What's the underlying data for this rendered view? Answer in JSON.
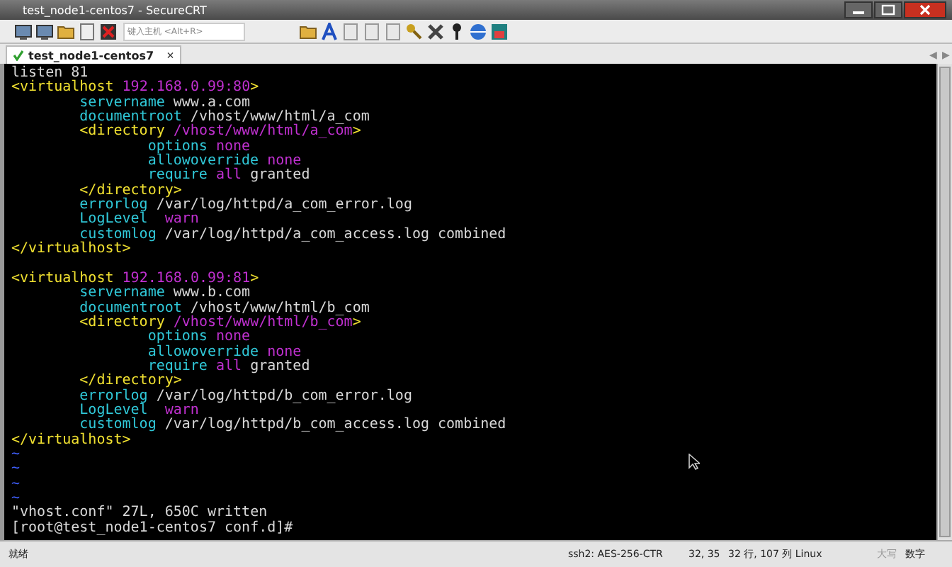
{
  "window": {
    "title": "test_node1-centos7 - SecureCRT"
  },
  "toolbar": {
    "host_field": {
      "placeholder": "键入主机 <Alt+R>"
    }
  },
  "tabs": [
    {
      "label": "test_node1-centos7",
      "selected": true,
      "connected": true,
      "close": "×"
    }
  ],
  "tab_scroll": [
    "◀",
    "▶"
  ],
  "terminal": {
    "lines": [
      {
        "kind": "text",
        "segments": [
          {
            "kind": "plain",
            "text": "listen 81"
          }
        ]
      },
      {
        "kind": "text",
        "segments": [
          {
            "kind": "tag",
            "text": "<virtualhost "
          },
          {
            "kind": "value",
            "text": "192.168.0.99:80"
          },
          {
            "kind": "tag",
            "text": ">"
          }
        ],
        "children": [
          {
            "kind": "text",
            "segments": [
              {
                "kind": "attr",
                "text": "servername"
              },
              {
                "kind": "plain",
                "text": " www.a.com"
              }
            ]
          },
          {
            "kind": "text",
            "segments": [
              {
                "kind": "attr",
                "text": "documentroot"
              },
              {
                "kind": "plain",
                "text": " /vhost/www/html/a_com"
              }
            ]
          },
          {
            "kind": "text",
            "segments": [
              {
                "kind": "tag",
                "text": "<directory "
              },
              {
                "kind": "value",
                "text": "/vhost/www/html/a_com"
              },
              {
                "kind": "tag",
                "text": ">"
              }
            ],
            "children": [
              {
                "kind": "text",
                "segments": [
                  {
                    "kind": "attr",
                    "text": "options"
                  },
                  {
                    "kind": "value",
                    "text": " none"
                  }
                ]
              },
              {
                "kind": "text",
                "segments": [
                  {
                    "kind": "attr",
                    "text": "allowoverride"
                  },
                  {
                    "kind": "value",
                    "text": " none"
                  }
                ]
              },
              {
                "kind": "text",
                "segments": [
                  {
                    "kind": "attr",
                    "text": "require"
                  },
                  {
                    "kind": "value",
                    "text": " all"
                  },
                  {
                    "kind": "plain",
                    "text": " granted"
                  }
                ]
              }
            ]
          },
          {
            "kind": "text",
            "segments": [
              {
                "kind": "tag",
                "text": "</directory>"
              }
            ]
          },
          {
            "kind": "text",
            "segments": [
              {
                "kind": "attr",
                "text": "errorlog"
              },
              {
                "kind": "plain",
                "text": " /var/log/httpd/a_com_error.log"
              }
            ]
          },
          {
            "kind": "text",
            "segments": [
              {
                "kind": "attr",
                "text": "LogLevel"
              },
              {
                "kind": "value",
                "text": "  warn"
              }
            ]
          },
          {
            "kind": "text",
            "segments": [
              {
                "kind": "attr",
                "text": "customlog"
              },
              {
                "kind": "plain",
                "text": " /var/log/httpd/a_com_access.log combined"
              }
            ]
          }
        ]
      },
      {
        "kind": "text",
        "segments": [
          {
            "kind": "tag",
            "text": "</virtualhost>"
          }
        ]
      },
      {
        "kind": "blank"
      },
      {
        "kind": "text",
        "segments": [
          {
            "kind": "tag",
            "text": "<virtualhost "
          },
          {
            "kind": "value",
            "text": "192.168.0.99:81"
          },
          {
            "kind": "tag",
            "text": ">"
          }
        ],
        "children": [
          {
            "kind": "text",
            "segments": [
              {
                "kind": "attr",
                "text": "servername"
              },
              {
                "kind": "plain",
                "text": " www.b.com"
              }
            ]
          },
          {
            "kind": "text",
            "segments": [
              {
                "kind": "attr",
                "text": "documentroot"
              },
              {
                "kind": "plain",
                "text": " /vhost/www/html/b_com"
              }
            ]
          },
          {
            "kind": "text",
            "segments": [
              {
                "kind": "tag",
                "text": "<directory "
              },
              {
                "kind": "value",
                "text": "/vhost/www/html/b_com"
              },
              {
                "kind": "tag",
                "text": ">"
              }
            ],
            "children": [
              {
                "kind": "text",
                "segments": [
                  {
                    "kind": "attr",
                    "text": "options"
                  },
                  {
                    "kind": "value",
                    "text": " none"
                  }
                ]
              },
              {
                "kind": "text",
                "segments": [
                  {
                    "kind": "attr",
                    "text": "allowoverride"
                  },
                  {
                    "kind": "value",
                    "text": " none"
                  }
                ]
              },
              {
                "kind": "text",
                "segments": [
                  {
                    "kind": "attr",
                    "text": "require"
                  },
                  {
                    "kind": "value",
                    "text": " all"
                  },
                  {
                    "kind": "plain",
                    "text": " granted"
                  }
                ]
              }
            ]
          },
          {
            "kind": "text",
            "segments": [
              {
                "kind": "tag",
                "text": "</directory>"
              }
            ]
          },
          {
            "kind": "text",
            "segments": [
              {
                "kind": "attr",
                "text": "errorlog"
              },
              {
                "kind": "plain",
                "text": " /var/log/httpd/b_com_error.log"
              }
            ]
          },
          {
            "kind": "text",
            "segments": [
              {
                "kind": "attr",
                "text": "LogLevel"
              },
              {
                "kind": "value",
                "text": "  warn"
              }
            ]
          },
          {
            "kind": "text",
            "segments": [
              {
                "kind": "attr",
                "text": "customlog"
              },
              {
                "kind": "plain",
                "text": " /var/log/httpd/b_com_access.log combined"
              }
            ]
          }
        ]
      },
      {
        "kind": "text",
        "segments": [
          {
            "kind": "tag",
            "text": "</virtualhost>"
          }
        ]
      },
      {
        "kind": "text",
        "segments": [
          {
            "kind": "tilde",
            "text": "~"
          }
        ]
      },
      {
        "kind": "text",
        "segments": [
          {
            "kind": "tilde",
            "text": "~"
          }
        ]
      },
      {
        "kind": "text",
        "segments": [
          {
            "kind": "tilde",
            "text": "~"
          }
        ]
      },
      {
        "kind": "text",
        "segments": [
          {
            "kind": "tilde",
            "text": "~"
          }
        ]
      },
      {
        "kind": "text",
        "segments": [
          {
            "kind": "plain",
            "text": "\"vhost.conf\" 27L, 650C written"
          }
        ]
      },
      {
        "kind": "text",
        "segments": [
          {
            "kind": "plain",
            "text": "[root@test_node1-centos7 conf.d]#"
          }
        ]
      }
    ]
  },
  "status_bar": [
    {
      "text": "就绪",
      "disabled": false
    },
    {
      "text": "ssh2: AES-256-CTR",
      "disabled": false
    },
    {
      "text": "32,  35",
      "disabled": false
    },
    {
      "text": "32 行, 107 列 Linux",
      "disabled": false
    },
    {
      "text": "大写",
      "disabled": true
    },
    {
      "text": "数字",
      "disabled": false
    }
  ]
}
